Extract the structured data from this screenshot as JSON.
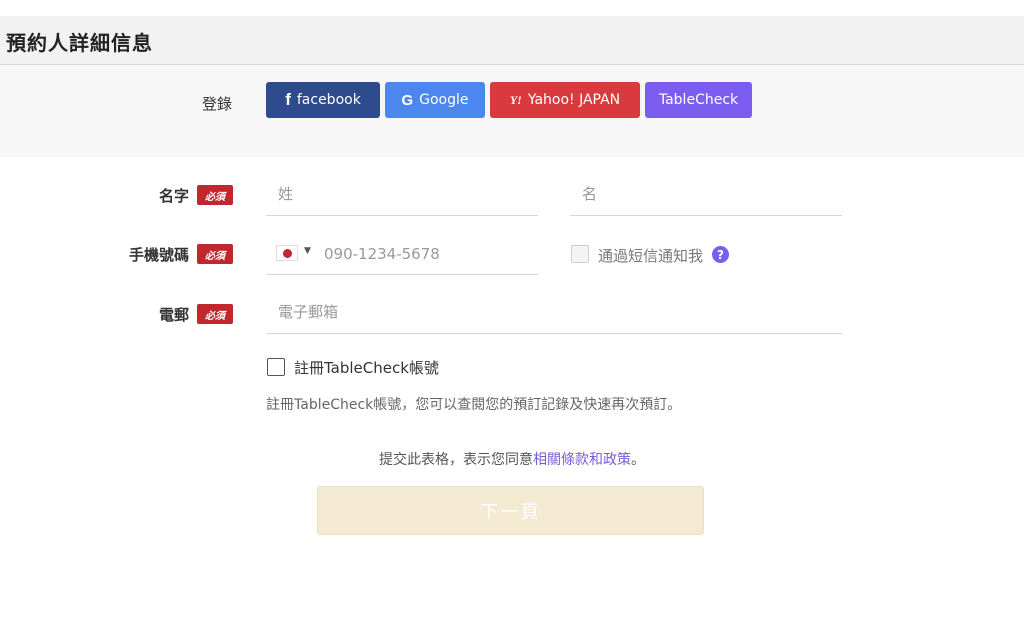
{
  "header": {
    "title": "預約人詳細信息"
  },
  "login": {
    "label": "登錄",
    "buttons": [
      {
        "icon": "facebook-icon",
        "icon_glyph": "f",
        "label": "facebook",
        "color": "#2d4b8d"
      },
      {
        "icon": "google-icon",
        "icon_glyph": "G",
        "label": "Google",
        "color": "#4b87ee"
      },
      {
        "icon": "yahoo-icon",
        "icon_glyph": "Y!",
        "label": "Yahoo! JAPAN",
        "color": "#d93a3e"
      },
      {
        "icon": "",
        "icon_glyph": "",
        "label": "TableCheck",
        "color": "#7b5ef0"
      }
    ]
  },
  "form": {
    "required_badge": "必須",
    "name": {
      "label": "名字",
      "last_placeholder": "姓",
      "first_placeholder": "名"
    },
    "phone": {
      "label": "手機號碼",
      "country_flag": "japan-flag-icon",
      "placeholder": "090-1234-5678",
      "sms_label": "通過短信通知我",
      "help_glyph": "?"
    },
    "email": {
      "label": "電郵",
      "placeholder": "電子郵箱"
    },
    "register": {
      "label": "註冊TableCheck帳號",
      "description": "註冊TableCheck帳號，您可以查閱您的預訂記錄及快速再次預訂。"
    }
  },
  "terms": {
    "prefix": "提交此表格，表示您同意",
    "link": "相關條款和政策",
    "suffix": "。"
  },
  "next_button": {
    "label": "下一頁",
    "color": "#f4ead2"
  },
  "colors": {
    "required_badge": "#c0282e",
    "accent": "#7b5ef0",
    "link": "#7a5bd6"
  }
}
